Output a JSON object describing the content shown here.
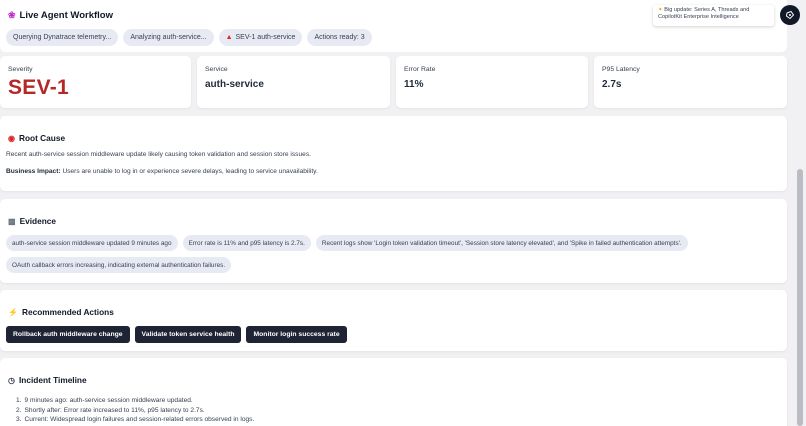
{
  "workflow": {
    "title": "Live Agent Workflow",
    "title_icon": "brain-icon",
    "chips": [
      {
        "label": "Querying Dynatrace telemetry..."
      },
      {
        "label": "Analyzing auth-service..."
      },
      {
        "label": "SEV-1 auth-service",
        "icon": "alert-icon"
      },
      {
        "label": "Actions ready: 3"
      }
    ]
  },
  "toast": {
    "line1": "Big update: Series A, Threads and",
    "line2": "CopilotKit Enterprise Intelligence"
  },
  "metrics": [
    {
      "label": "Severity",
      "value": "SEV-1"
    },
    {
      "label": "Service",
      "value": "auth-service"
    },
    {
      "label": "Error Rate",
      "value": "11%"
    },
    {
      "label": "P95 Latency",
      "value": "2.7s"
    }
  ],
  "root_cause": {
    "title": "Root Cause",
    "icon": "target-icon",
    "summary": "Recent auth-service session middleware update likely causing token validation and session store issues.",
    "impact_label": "Business Impact:",
    "impact_text": " Users are unable to log in or experience severe delays, leading to service unavailability."
  },
  "evidence": {
    "title": "Evidence",
    "icon": "chart-icon",
    "items": [
      "auth-service session middleware updated 9 minutes ago",
      "Error rate is 11% and p95 latency is 2.7s.",
      "Recent logs show 'Login token validation timeout', 'Session store latency elevated', and 'Spike in failed authentication attempts'.",
      "OAuth callback errors increasing, indicating external authentication failures."
    ]
  },
  "actions": {
    "title": "Recommended Actions",
    "icon": "lightning-icon",
    "buttons": [
      "Rollback auth middleware change",
      "Validate token service health",
      "Monitor login success rate"
    ]
  },
  "timeline": {
    "title": "Incident Timeline",
    "icon": "clock-icon",
    "entries": [
      {
        "num": "1.",
        "text": "9 minutes ago: auth-service session middleware updated."
      },
      {
        "num": "2.",
        "text": "Shortly after: Error rate increased to 11%, p95 latency to 2.7s."
      },
      {
        "num": "3.",
        "text": "Current: Widespread login failures and session-related errors observed in logs."
      }
    ]
  },
  "colors": {
    "severity": "#b42828",
    "action_button": "#1e2433",
    "chip_bg": "#e8eaf3"
  }
}
